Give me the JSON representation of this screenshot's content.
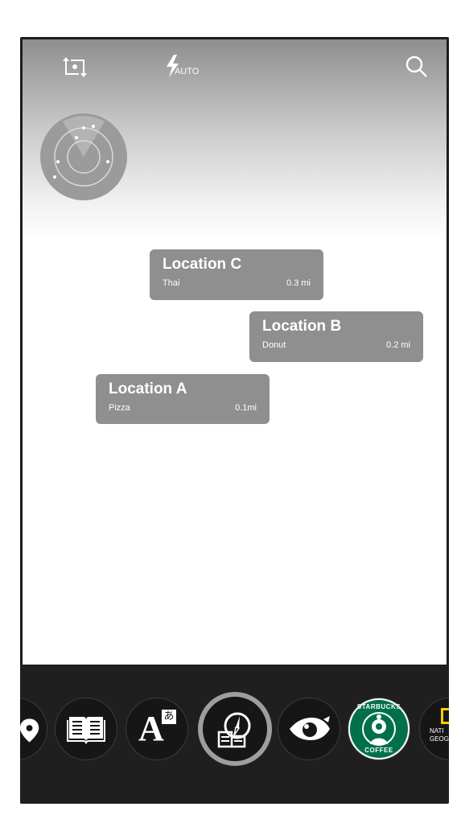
{
  "toolbar": {
    "switch_camera_icon": "switch-camera-icon",
    "flash_label": "AUTO",
    "search_icon": "search-icon"
  },
  "radar": {
    "icon": "radar-icon"
  },
  "locations": [
    {
      "name": "Location C",
      "category": "Thai",
      "distance": "0.3 mi"
    },
    {
      "name": "Location B",
      "category": "Donut",
      "distance": "0.2 mi"
    },
    {
      "name": "Location A",
      "category": "Pizza",
      "distance": "0.1mi"
    }
  ],
  "lens_tray": {
    "items": [
      {
        "name": "place-pin-icon"
      },
      {
        "name": "book-icon"
      },
      {
        "name": "translate-icon",
        "glyph": "A",
        "sub_glyph": "あ"
      },
      {
        "name": "compass-book-icon",
        "active": true
      },
      {
        "name": "eye-icon"
      },
      {
        "name": "starbucks-logo",
        "text_top": "STARBUCKS",
        "text_bottom": "COFFEE"
      },
      {
        "name": "nat-geo-logo",
        "text_line1": "NATI",
        "text_line2": "GEOG"
      }
    ]
  },
  "colors": {
    "card_bg": "#8f8f8f",
    "tray_bg": "#1f1f1f",
    "starbucks_green": "#00704a",
    "natgeo_yellow": "#ffce00"
  }
}
